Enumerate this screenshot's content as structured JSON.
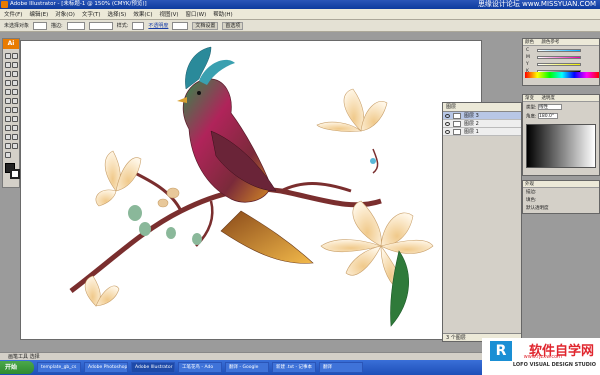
{
  "window": {
    "title": "Adobe Illustrator - [未标题-1 @ 150% (CMYK/预览)]"
  },
  "watermark": {
    "top_text": "思缘设计论坛 www.MISSYUAN.COM",
    "logo_text": "软件自学网",
    "url": "www.rjzxw.com",
    "sub_text": "LOFO VISUAL DESIGN STUDIO"
  },
  "menu": [
    "文件(F)",
    "编辑(E)",
    "对象(O)",
    "文字(T)",
    "选择(S)",
    "效果(C)",
    "视图(V)",
    "窗口(W)",
    "帮助(H)"
  ],
  "options": {
    "label_selection": "未选择对象",
    "stroke": "描边:",
    "style": "样式:",
    "opacity": "不透明度",
    "doc_setup": "文档设置",
    "prefs": "首选项"
  },
  "toolbox": {
    "logo": "Ai"
  },
  "layers_panel": {
    "title": "图层",
    "layers": [
      {
        "name": "图层 3",
        "selected": true
      },
      {
        "name": "图层 2",
        "selected": false
      },
      {
        "name": "图层 1",
        "selected": false
      }
    ],
    "footer": "3 个图层"
  },
  "color_panel": {
    "tab1": "颜色",
    "tab2": "颜色参考",
    "labels": [
      "C",
      "M",
      "Y",
      "K"
    ]
  },
  "gradient_panel": {
    "tab1": "渐变",
    "tab2": "透明度",
    "type_label": "类型:",
    "type_value": "线性",
    "angle_label": "角度:",
    "angle_value": "180.0°"
  },
  "style_panel": {
    "title": "外观",
    "fill": "描边:",
    "stroke": "填色:",
    "opacity": "默认透明度"
  },
  "statusbar": {
    "text": "画笔工具 选择"
  },
  "taskbar": {
    "start": "开始",
    "tasks": [
      {
        "label": "template_gb_cs",
        "active": false
      },
      {
        "label": "Adobe Photoshop",
        "active": false
      },
      {
        "label": "Adobe Illustrator",
        "active": true
      },
      {
        "label": "工笔花鸟 - Ado",
        "active": false
      },
      {
        "label": "翻译 - Google",
        "active": false
      },
      {
        "label": "新建 .txt - 记事本",
        "active": false
      },
      {
        "label": "翻译",
        "active": false
      }
    ]
  }
}
